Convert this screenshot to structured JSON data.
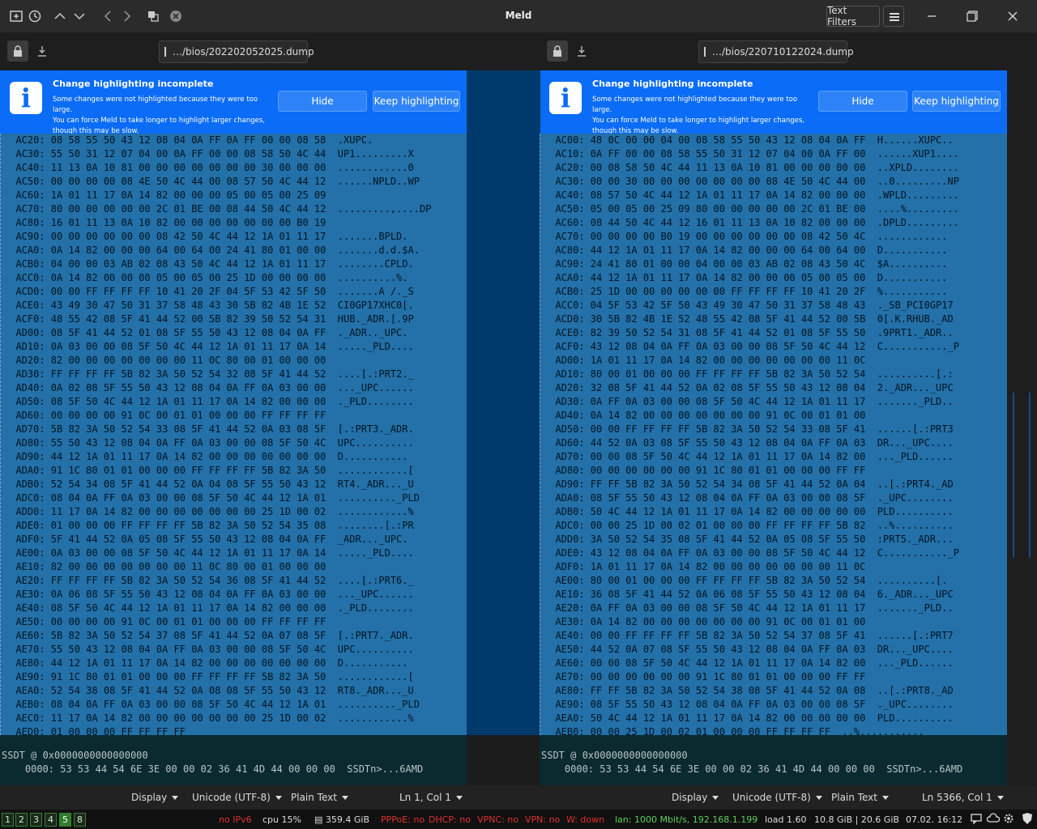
{
  "window": {
    "title": "Meld",
    "text_filters": "Text Filters"
  },
  "left": {
    "file": "…/bios/202202052025.dump",
    "info": {
      "title": "Change highlighting incomplete",
      "line1": "Some changes were not highlighted because they were too large.",
      "line2": "You can force Meld to take longer to highlight larger changes,",
      "line3": "though this may be slow.",
      "hide": "Hide",
      "keep": "Keep highlighting"
    },
    "rows": [
      "  AC20: 08 58 55 50 43 12 08 04 0A FF 0A FF 00 00 08 58  .XUPC.",
      "  AC30: 55 50 31 12 07 04 00 0A FF 00 00 08 58 50 4C 44  UP1.........X",
      "  AC40: 11 13 0A 10 81 00 00 00 00 00 00 00 30 00 00 00  ............0",
      "  AC50: 00 00 00 00 08 4E 50 4C 44 00 08 57 50 4C 44 12  ......NPLD..WP",
      "  AC60: 1A 01 11 17 0A 14 82 00 00 00 05 00 05 00 25 09  ",
      "  AC70: 80 00 00 00 00 00 2C 01 BE 00 08 44 50 4C 44 12  .........,....DP",
      "  AC80: 16 01 11 13 0A 10 82 00 00 00 00 00 00 00 B0 19  ",
      "  AC90: 00 00 00 00 00 00 08 42 50 4C 44 12 1A 01 11 17  .......BPLD.",
      "  ACA0: 0A 14 82 00 00 00 64 00 64 00 24 41 80 01 00 00  .......d.d.$A.",
      "  ACB0: 04 00 00 03 AB 02 08 43 50 4C 44 12 1A 01 11 17  ........CPLD.",
      "  ACC0: 0A 14 82 00 00 00 05 00 05 00 25 1D 00 00 00 00  ..........%.",
      "  ACD0: 00 00 FF FF FF FF 10 41 20 2F 04 5F 53 42 5F 50  .......A /._S",
      "  ACE0: 43 49 30 47 50 31 37 58 48 43 30 5B 82 4B 1E 52  CI0GP17XHC0[.",
      "  ACF0: 48 55 42 08 5F 41 44 52 00 5B 82 39 50 52 54 31  HUB._ADR.[.9P",
      "  AD00: 08 5F 41 44 52 01 08 5F 55 50 43 12 08 04 0A FF  ._ADR.._UPC.",
      "  AD10: 0A 03 00 00 08 5F 50 4C 44 12 1A 01 11 17 0A 14  ....._PLD....",
      "  AD20: 82 00 00 00 00 00 00 00 11 0C 80 00 01 00 00 00  ",
      "  AD30: FF FF FF FF 5B 82 3A 50 52 54 32 08 5F 41 44 52  ....[.:PRT2._",
      "  AD40: 0A 02 08 5F 55 50 43 12 08 04 0A FF 0A 03 00 00  ..._UPC......",
      "  AD50: 08 5F 50 4C 44 12 1A 01 11 17 0A 14 82 00 00 00  ._PLD........",
      "  AD60: 00 00 00 00 91 0C 00 01 01 00 00 00 FF FF FF FF  ",
      "  AD70: 5B 82 3A 50 52 54 33 08 5F 41 44 52 0A 03 08 5F  [.:PRT3._ADR.",
      "  AD80: 55 50 43 12 08 04 0A FF 0A 03 00 00 08 5F 50 4C  UPC..........",
      "  AD90: 44 12 1A 01 11 17 0A 14 82 00 00 00 00 00 00 00  D...........",
      "  ADA0: 91 1C 80 01 01 00 00 00 FF FF FF FF 5B 82 3A 50  ............[",
      "  ADB0: 52 54 34 08 5F 41 44 52 0A 04 08 5F 55 50 43 12  RT4._ADR..._U",
      "  ADC0: 08 04 0A FF 0A 03 00 00 08 5F 50 4C 44 12 1A 01  .........._PLD",
      "  ADD0: 11 17 0A 14 82 00 00 00 00 00 00 00 25 1D 00 02  ............%",
      "  ADE0: 01 00 00 00 FF FF FF FF 5B 82 3A 50 52 54 35 08  ........[.:PR",
      "  ADF0: 5F 41 44 52 0A 05 08 5F 55 50 43 12 08 04 0A FF  _ADR..._UPC.",
      "  AE00: 0A 03 00 00 08 5F 50 4C 44 12 1A 01 11 17 0A 14  ....._PLD....",
      "  AE10: 82 00 00 00 00 00 00 00 11 0C 80 00 01 00 00 00  ",
      "  AE20: FF FF FF FF 5B 82 3A 50 52 54 36 08 5F 41 44 52  ....[.:PRT6._",
      "  AE30: 0A 06 08 5F 55 50 43 12 08 04 0A FF 0A 03 00 00  ..._UPC......",
      "  AE40: 08 5F 50 4C 44 12 1A 01 11 17 0A 14 82 00 00 00  ._PLD........",
      "  AE50: 00 00 00 00 91 0C 00 01 01 00 00 00 FF FF FF FF  ",
      "  AE60: 5B 82 3A 50 52 54 37 08 5F 41 44 52 0A 07 08 5F  [.:PRT7._ADR.",
      "  AE70: 55 50 43 12 08 04 0A FF 0A 03 00 00 08 5F 50 4C  UPC..........",
      "  AE80: 44 12 1A 01 11 17 0A 14 82 00 00 00 00 00 00 00  D...........",
      "  AE90: 91 1C 80 01 01 00 00 00 FF FF FF FF 5B 82 3A 50  ............[",
      "  AEA0: 52 54 38 08 5F 41 44 52 0A 08 08 5F 55 50 43 12  RT8._ADR..._U",
      "  AEB0: 08 04 0A FF 0A 03 00 00 08 5F 50 4C 44 12 1A 01  .........._PLD",
      "  AEC0: 11 17 0A 14 82 00 00 00 00 00 00 00 25 1D 00 02  ............%",
      "  AED0: 01 00 00 00 FF FF FF FF"
    ],
    "lower_rows": [
      "SSDT @ 0x0000000000000000",
      "    0000: 53 53 44 54 6E 3E 00 00 02 36 41 4D 44 00 00 00  SSDTn>...6AMD"
    ],
    "status": {
      "display": "Display",
      "encoding": "Unicode (UTF-8)",
      "syntax": "Plain Text",
      "position": "Ln 1, Col 1"
    }
  },
  "right": {
    "file": "…/bios/220710122024.dump",
    "info": {
      "title": "Change highlighting incomplete",
      "line1": "Some changes were not highlighted because they were too large.",
      "line2": "You can force Meld to take longer to highlight larger changes,",
      "line3": "though this may be slow.",
      "hide": "Hide",
      "keep": "Keep highlighting"
    },
    "rows": [
      "  AC00: 48 0C 00 00 04 00 08 58 55 50 43 12 08 04 0A FF  H......XUPC..",
      "  AC10: 0A FF 00 00 08 58 55 50 31 12 07 04 00 0A FF 00  ......XUP1....",
      "  AC20: 00 08 58 50 4C 44 11 13 0A 10 81 00 00 00 00 00  ..XPLD........",
      "  AC30: 00 00 30 00 00 00 00 00 00 00 08 4E 50 4C 44 00  ..0.........NP",
      "  AC40: 08 57 50 4C 44 12 1A 01 11 17 0A 14 82 00 00 00  .WPLD.........",
      "  AC50: 05 00 05 00 25 09 80 00 00 00 00 00 2C 01 BE 00  ....%.........",
      "  AC60: 08 44 50 4C 44 12 16 01 11 13 0A 10 82 00 00 00  .DPLD.........",
      "  AC70: 00 00 00 00 B0 19 00 00 00 00 00 00 08 42 50 4C  ............",
      "  AC80: 44 12 1A 01 11 17 0A 14 82 00 00 00 64 00 64 00  D...........",
      "  AC90: 24 41 80 01 00 00 04 00 00 03 AB 02 08 43 50 4C  $A..........",
      "  ACA0: 44 12 1A 01 11 17 0A 14 82 00 00 00 05 00 05 00  D...........",
      "  ACB0: 25 1D 00 00 00 00 00 00 FF FF FF FF 10 41 20 2F  %...........",
      "  ACC0: 04 5F 53 42 5F 50 43 49 30 47 50 31 37 58 48 43  ._SB_PCI0GP17",
      "  ACD0: 30 5B 82 4B 1E 52 48 55 42 08 5F 41 44 52 00 5B  0[.K.RHUB._AD",
      "  ACE0: 82 39 50 52 54 31 08 5F 41 44 52 01 08 5F 55 50  .9PRT1._ADR..",
      "  ACF0: 43 12 08 04 0A FF 0A 03 00 00 08 5F 50 4C 44 12  C..........._P",
      "  AD00: 1A 01 11 17 0A 14 82 00 00 00 00 00 00 00 11 0C  ",
      "  AD10: 80 00 01 00 00 00 FF FF FF FF 5B 82 3A 50 52 54  ..........[.:",
      "  AD20: 32 08 5F 41 44 52 0A 02 08 5F 55 50 43 12 08 04  2._ADR..._UPC",
      "  AD30: 0A FF 0A 03 00 00 08 5F 50 4C 44 12 1A 01 11 17  ......._PLD..",
      "  AD40: 0A 14 82 00 00 00 00 00 00 00 91 0C 00 01 01 00  ",
      "  AD50: 00 00 FF FF FF FF 5B 82 3A 50 52 54 33 08 5F 41  ......[.:PRT3",
      "  AD60: 44 52 0A 03 08 5F 55 50 43 12 08 04 0A FF 0A 03  DR..._UPC....",
      "  AD70: 00 00 08 5F 50 4C 44 12 1A 01 11 17 0A 14 82 00  ..._PLD......",
      "  AD80: 00 00 00 00 00 00 91 1C 80 01 01 00 00 00 FF FF  ",
      "  AD90: FF FF 5B 82 3A 50 52 54 34 08 5F 41 44 52 0A 04  ..[.:PRT4._AD",
      "  ADA0: 08 5F 55 50 43 12 08 04 0A FF 0A 03 00 00 08 5F  ._UPC........",
      "  ADB0: 50 4C 44 12 1A 01 11 17 0A 14 82 00 00 00 00 00  PLD..........",
      "  ADC0: 00 00 25 1D 00 02 01 00 00 00 FF FF FF FF 5B 82  ..%..........",
      "  ADD0: 3A 50 52 54 35 08 5F 41 44 52 0A 05 08 5F 55 50  :PRT5._ADR...",
      "  ADE0: 43 12 08 04 0A FF 0A 03 00 00 08 5F 50 4C 44 12  C..........._P",
      "  ADF0: 1A 01 11 17 0A 14 82 00 00 00 00 00 00 00 11 0C  ",
      "  AE00: 80 00 01 00 00 00 FF FF FF FF 5B 82 3A 50 52 54  ..........[.",
      "  AE10: 36 08 5F 41 44 52 0A 06 08 5F 55 50 43 12 08 04  6._ADR..._UPC",
      "  AE20: 0A FF 0A 03 00 00 08 5F 50 4C 44 12 1A 01 11 17  ......._PLD..",
      "  AE30: 0A 14 82 00 00 00 00 00 00 00 91 0C 00 01 01 00  ",
      "  AE40: 00 00 FF FF FF FF 5B 82 3A 50 52 54 37 08 5F 41  ......[.:PRT7",
      "  AE50: 44 52 0A 07 08 5F 55 50 43 12 08 04 0A FF 0A 03  DR..._UPC....",
      "  AE60: 00 00 08 5F 50 4C 44 12 1A 01 11 17 0A 14 82 00  ..._PLD......",
      "  AE70: 00 00 00 00 00 00 91 1C 80 01 01 00 00 00 FF FF  ",
      "  AE80: FF FF 5B 82 3A 50 52 54 38 08 5F 41 44 52 0A 08  ..[.:PRT8._AD",
      "  AE90: 08 5F 55 50 43 12 08 04 0A FF 0A 03 00 00 08 5F  ._UPC........",
      "  AEA0: 50 4C 44 12 1A 01 11 17 0A 14 82 00 00 00 00 00  PLD..........",
      "  AEB0: 00 00 25 1D 00 02 01 00 00 00 FF FF FF FF  ..%..........."
    ],
    "lower_rows": [
      "SSDT @ 0x0000000000000000",
      "    0000: 53 53 44 54 6E 3E 00 00 02 36 41 4D 44 00 00 00  SSDTn>...6AMD"
    ],
    "status": {
      "display": "Display",
      "encoding": "Unicode (UTF-8)",
      "syntax": "Plain Text",
      "position": "Ln 5366, Col 1"
    }
  },
  "tray": {
    "workspaces": [
      "1",
      "2",
      "3",
      "4",
      "5",
      "8"
    ],
    "active_workspace": "5",
    "ipv6": "no IPv6",
    "cpu": "cpu  15%",
    "disk": "359.4 GiB",
    "pppoe": "PPPoE: no",
    "dhcp": "DHCP: no",
    "vpnc": "VPNC: no",
    "vpn": "VPN: no",
    "wifi": "W: down",
    "lan": "lan: 1000 Mbit/s, 192.168.1.199",
    "load": "load 1.60",
    "mem": "10.8 GiB | 20.6 GiB",
    "datetime": "07.02. 16:12"
  }
}
